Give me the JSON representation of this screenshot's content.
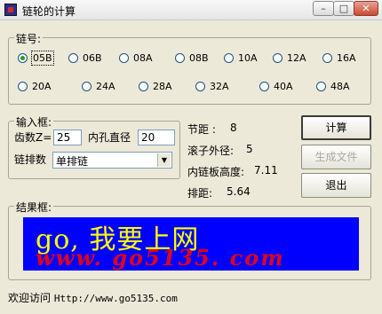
{
  "window": {
    "title": "链轮的计算",
    "min": "–",
    "max": "□",
    "close": "✕"
  },
  "chain_group": {
    "title": "链号:",
    "options": [
      "05B",
      "06B",
      "08A",
      "08B",
      "10A",
      "12A",
      "16A",
      "20A",
      "24A",
      "28A",
      "32A",
      "40A",
      "48A"
    ],
    "selected": "05B"
  },
  "input_group": {
    "title": "输入框:",
    "teeth_label": "齿数Z=",
    "teeth_value": "25",
    "bore_label": "内孔直径",
    "bore_value": "20",
    "rows_label": "链排数",
    "rows_value": "单排链"
  },
  "results": {
    "pitch_label": "节距 :",
    "pitch_value": "8",
    "roller_label": "滚子外径:",
    "roller_value": "5",
    "plate_label": "内链板高度:",
    "plate_value": "7.11",
    "spacing_label": "排距:",
    "spacing_value": "5.64"
  },
  "buttons": {
    "calc": "计算",
    "gen_file": "生成文件",
    "exit": "退出"
  },
  "result_group": {
    "title": "结果框:",
    "banner_line1": "go, 我要上网",
    "banner_line2": "www. go5135. com"
  },
  "footer": {
    "welcome": "欢迎访问",
    "url": "Http://www.go5135.com"
  },
  "colors": {
    "banner_bg": "#0000FF",
    "banner_text1": "#FFFF00",
    "banner_text2": "#E4001A",
    "window_bg": "#ECE9D8"
  }
}
